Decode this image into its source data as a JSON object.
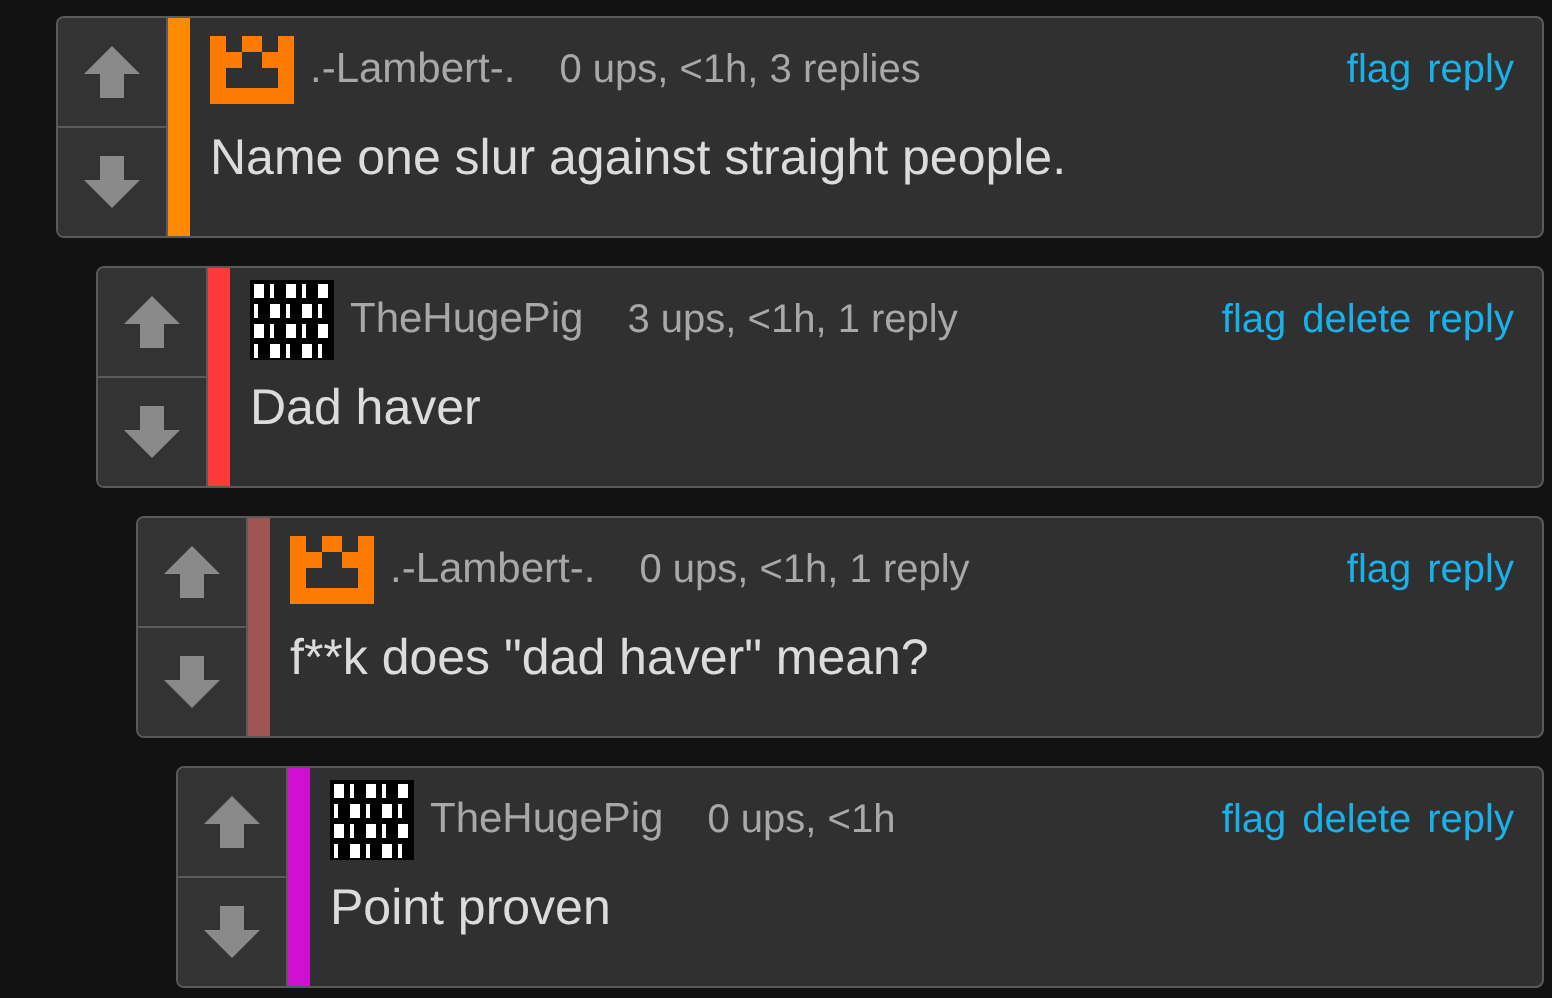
{
  "comments": [
    {
      "username": ".-Lambert-.",
      "avatar": {
        "kind": "castle"
      },
      "meta": "0 ups, <1h, 3 replies",
      "actions": [
        "flag",
        "reply"
      ],
      "text": "Name one slur against straight people.",
      "color": "#ff8a00",
      "children": [
        {
          "username": "TheHugePig",
          "avatar": {
            "kind": "binary"
          },
          "meta": "3 ups, <1h, 1 reply",
          "actions": [
            "flag",
            "delete",
            "reply"
          ],
          "text": "Dad haver",
          "color": "#ff3838",
          "children": [
            {
              "username": ".-Lambert-.",
              "avatar": {
                "kind": "castle"
              },
              "meta": "0 ups, <1h, 1 reply",
              "actions": [
                "flag",
                "reply"
              ],
              "text": "f**k does \"dad haver\" mean?",
              "color": "#a05555",
              "children": [
                {
                  "username": "TheHugePig",
                  "avatar": {
                    "kind": "binary"
                  },
                  "meta": "0 ups, <1h",
                  "actions": [
                    "flag",
                    "delete",
                    "reply"
                  ],
                  "text": "Point proven",
                  "color": "#d010d0"
                }
              ]
            }
          ]
        }
      ]
    }
  ]
}
